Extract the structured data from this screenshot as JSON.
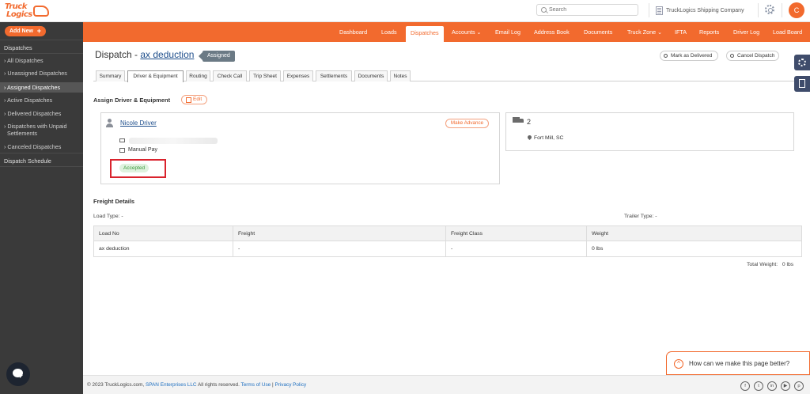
{
  "brand": {
    "logo_line1": "Truck",
    "logo_line2": "Logics",
    "accent": "#f26a2e"
  },
  "header": {
    "search_placeholder": "Search",
    "company": "TruckLogics Shipping Company",
    "avatar_initial": "C"
  },
  "sidebar": {
    "add_new": "Add New",
    "group_dispatches": "Dispatches",
    "items": [
      {
        "label": "All Dispatches"
      },
      {
        "label": "Unassigned Dispatches"
      },
      {
        "label": "Assigned Dispatches"
      },
      {
        "label": "Active Dispatches"
      },
      {
        "label": "Delivered Dispatches"
      },
      {
        "label": "Dispatches with Unpaid"
      },
      {
        "label": "Canceled Dispatches"
      }
    ],
    "unpaid_line2": "Settlements",
    "dispatch_schedule": "Dispatch Schedule"
  },
  "nav": {
    "items": [
      {
        "label": "Dashboard"
      },
      {
        "label": "Loads"
      },
      {
        "label": "Dispatches"
      },
      {
        "label": "Accounts ⌄"
      },
      {
        "label": "Email Log"
      },
      {
        "label": "Address Book"
      },
      {
        "label": "Documents"
      },
      {
        "label": "Truck Zone ⌄"
      },
      {
        "label": "IFTA"
      },
      {
        "label": "Reports"
      },
      {
        "label": "Driver Log"
      },
      {
        "label": "Load Board"
      }
    ]
  },
  "dispatch": {
    "title_prefix": "Dispatch - ",
    "title_link": "ax deduction",
    "status": "Assigned",
    "mark_delivered": "Mark as Delivered",
    "cancel": "Cancel Dispatch"
  },
  "tabs": [
    {
      "label": "Summary"
    },
    {
      "label": "Driver & Equipment"
    },
    {
      "label": "Routing"
    },
    {
      "label": "Check Call"
    },
    {
      "label": "Trip Sheet"
    },
    {
      "label": "Expenses"
    },
    {
      "label": "Settlements"
    },
    {
      "label": "Documents"
    },
    {
      "label": "Notes"
    }
  ],
  "assign": {
    "heading": "Assign Driver & Equipment",
    "edit": "Edit",
    "driver_name": "Nicole Driver",
    "make_advance": "Make Advance",
    "pay_type": "Manual Pay",
    "driver_status": "Accepted",
    "truck_number": "2",
    "location": "Fort Mill, SC"
  },
  "freight": {
    "heading": "Freight Details",
    "load_type": "Load Type: -",
    "trailer_type": "Trailer Type: -",
    "columns": [
      "Load No",
      "Freight",
      "Freight Class",
      "Weight"
    ],
    "rows": [
      [
        "ax deduction",
        "-",
        "-",
        "0 lbs"
      ]
    ],
    "total_label": "Total Weight:",
    "total_value": "0 lbs"
  },
  "footer": {
    "copyright": "© 2023 TruckLogics.com,",
    "company": "SPAN Enterprises LLC",
    "rights": "All rights reserved.",
    "terms": "Terms of Use",
    "sep": "|",
    "privacy": "Privacy Policy",
    "social": [
      "f",
      "t",
      "in",
      "▶",
      "p"
    ]
  },
  "feedback": {
    "text": "How can we make this page better?",
    "chevron": "^"
  }
}
